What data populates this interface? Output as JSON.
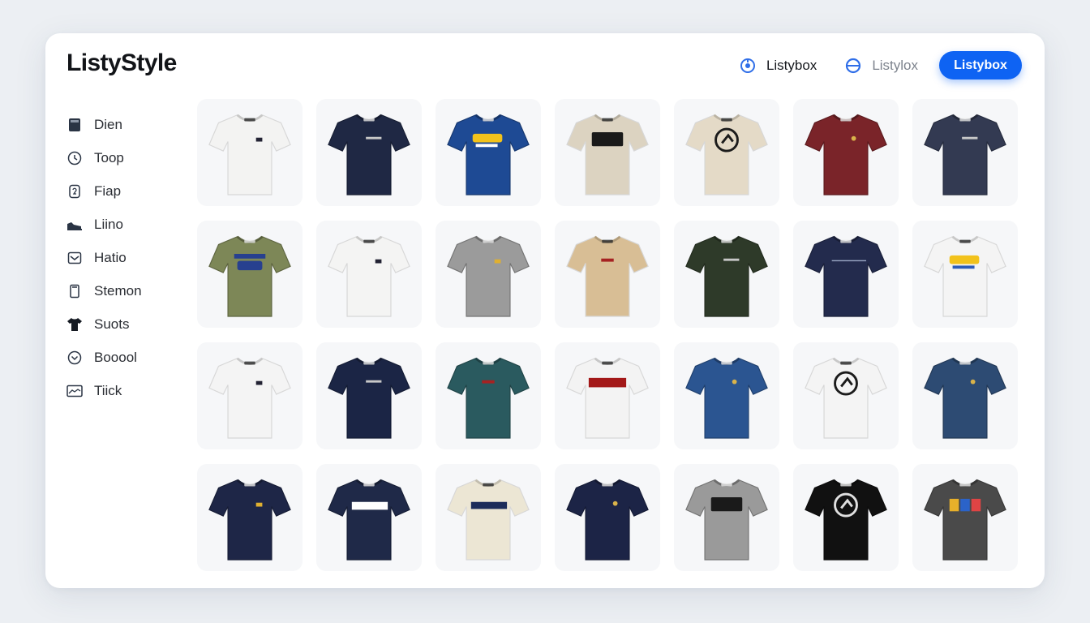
{
  "app": {
    "brand": "ListyStyle"
  },
  "topnav": {
    "link1": {
      "label": "Listybox",
      "icon": "target-icon"
    },
    "link2": {
      "label": "Listylox",
      "icon": "globe-icon"
    },
    "button": {
      "label": "Listybox"
    }
  },
  "colors": {
    "accent": "#0e63f3",
    "card_bg": "#f6f7f9"
  },
  "sidebar": {
    "items": [
      {
        "label": "Dien",
        "icon": "book-icon"
      },
      {
        "label": "Toop",
        "icon": "clock-icon"
      },
      {
        "label": "Fiap",
        "icon": "tag-icon"
      },
      {
        "label": "Liino",
        "icon": "shoe-icon"
      },
      {
        "label": "Hatio",
        "icon": "mail-icon"
      },
      {
        "label": "Stemon",
        "icon": "phone-icon"
      },
      {
        "label": "Suots",
        "icon": "tshirt-icon"
      },
      {
        "label": "Booool",
        "icon": "chevron-circle-icon"
      },
      {
        "label": "Tiick",
        "icon": "chart-icon"
      }
    ]
  },
  "products": [
    {
      "color": "#f3f3f2",
      "graphic": "small-patch"
    },
    {
      "color": "#1f2844",
      "graphic": "small-bar"
    },
    {
      "color": "#1e4a94",
      "graphic": "yellow-text-logo"
    },
    {
      "color": "#dcd3c1",
      "graphic": "black-text-logo"
    },
    {
      "color": "#e4dac7",
      "graphic": "circle-logo"
    },
    {
      "color": "#7a2429",
      "graphic": "small-circle"
    },
    {
      "color": "#333a52",
      "graphic": "small-bar"
    },
    {
      "color": "#7d8757",
      "graphic": "blue-text-logo"
    },
    {
      "color": "#f4f4f3",
      "graphic": "small-patch"
    },
    {
      "color": "#9b9b9b",
      "graphic": "small-patch"
    },
    {
      "color": "#d8be95",
      "graphic": "small-text"
    },
    {
      "color": "#2e3a29",
      "graphic": "small-bar"
    },
    {
      "color": "#232b4d",
      "graphic": "thin-text"
    },
    {
      "color": "#f4f4f4",
      "graphic": "yellow-text-logo"
    },
    {
      "color": "#f4f4f4",
      "graphic": "small-patch"
    },
    {
      "color": "#1b2545",
      "graphic": "small-bar"
    },
    {
      "color": "#2a5a5f",
      "graphic": "small-text"
    },
    {
      "color": "#f3f3f3",
      "graphic": "red-text-logo"
    },
    {
      "color": "#2b5591",
      "graphic": "small-circle"
    },
    {
      "color": "#f4f4f4",
      "graphic": "circle-logo"
    },
    {
      "color": "#2d4b73",
      "graphic": "small-circle"
    },
    {
      "color": "#1e2647",
      "graphic": "small-patch"
    },
    {
      "color": "#1f2948",
      "graphic": "white-text-logo"
    },
    {
      "color": "#ece6d4",
      "graphic": "navy-text-logo"
    },
    {
      "color": "#1c2446",
      "graphic": "small-circle"
    },
    {
      "color": "#9a9a9a",
      "graphic": "black-text-logo"
    },
    {
      "color": "#111111",
      "graphic": "circle-logo"
    },
    {
      "color": "#4a4a4a",
      "graphic": "multi-logo"
    }
  ]
}
